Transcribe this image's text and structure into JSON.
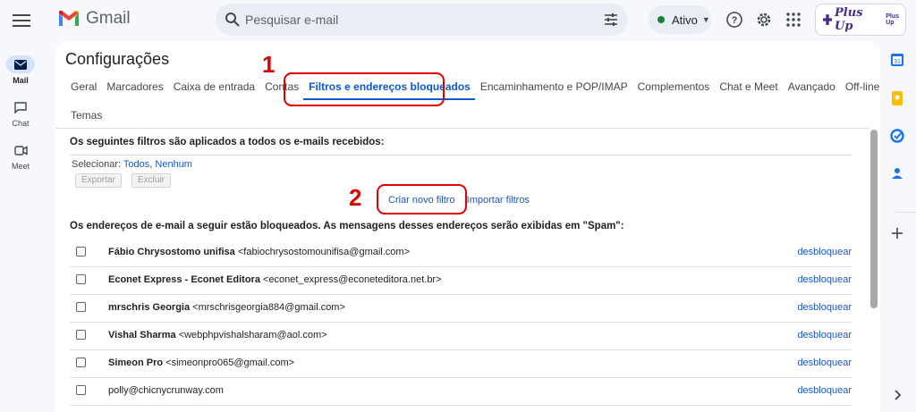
{
  "header": {
    "app_name": "Gmail",
    "search_placeholder": "Pesquisar e-mail",
    "status_label": "Ativo",
    "brand_text": "Plus Up",
    "brand_small": "Plus Up"
  },
  "rail": [
    {
      "label": "Mail",
      "icon": "mail-icon"
    },
    {
      "label": "Chat",
      "icon": "chat-icon"
    },
    {
      "label": "Meet",
      "icon": "meet-icon"
    }
  ],
  "settings": {
    "title": "Configurações",
    "tabs": [
      "Geral",
      "Marcadores",
      "Caixa de entrada",
      "Contas",
      "Filtros e endereços bloqueados",
      "Encaminhamento e POP/IMAP",
      "Complementos",
      "Chat e Meet",
      "Avançado",
      "Off-line"
    ],
    "tab_row2": "Temas",
    "filters_heading": "Os seguintes filtros são aplicados a todos os e-mails recebidos:",
    "select_label": "Selecionar:",
    "select_all": "Todos",
    "select_none": "Nenhum",
    "export_btn": "Exportar",
    "delete_btn": "Excluir",
    "create_filter": "Criar novo filtro",
    "import_filters": "Importar filtros",
    "blocked_heading": "Os endereços de e-mail a seguir estão bloqueados. As mensagens desses endereços serão exibidas em \"Spam\":",
    "unblock_label": "desbloquear",
    "blocked": [
      {
        "name": "Fábio Chrysostomo unifisa",
        "email": "<fabiochrysostomounifisa@gmail.com>"
      },
      {
        "name": "Econet Express - Econet Editora",
        "email": "<econet_express@econeteditora.net.br>"
      },
      {
        "name": "mrschris Georgia",
        "email": "<mrschrisgeorgia884@gmail.com>"
      },
      {
        "name": "Vishal Sharma",
        "email": "<webphpvishalsharam@aol.com>"
      },
      {
        "name": "Simeon Pro",
        "email": "<simeonpro065@gmail.com>"
      },
      {
        "name": "",
        "email": "polly@chicnycrunway.com"
      }
    ]
  },
  "annotations": {
    "n1": "1",
    "n2": "2"
  },
  "colors": {
    "accent": "#0b57d0",
    "annotation": "#e00000",
    "link": "#1a56c4"
  }
}
